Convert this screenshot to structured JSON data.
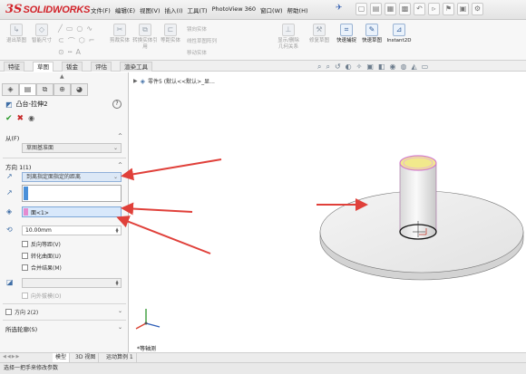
{
  "app": {
    "logo_mark": "3S",
    "logo_text": "SOLIDWORKS"
  },
  "menu": [
    "文件(F)",
    "编辑(E)",
    "视图(V)",
    "插入(I)",
    "工具(T)",
    "PhotoView 360",
    "窗口(W)",
    "帮助(H)"
  ],
  "ribbon": {
    "buttons": [
      {
        "label": "退出草图"
      },
      {
        "label": "智能尺寸"
      },
      {
        "label": "剪裁实体"
      },
      {
        "label": "转换实体引用"
      },
      {
        "label": "等距实体"
      },
      {
        "label": "显示/删除几何关系"
      },
      {
        "label": "修复草图"
      },
      {
        "label": "快速捕捉"
      },
      {
        "label": "快速草图"
      },
      {
        "label": "Instant2D"
      }
    ],
    "small_cmds": [
      "镜向实体",
      "线性草图阵列",
      "移动实体"
    ]
  },
  "cm_tabs": [
    "特征",
    "草图",
    "钣金",
    "评估",
    "渲染工具"
  ],
  "tree_flyout": "零件5 (默认<<默认>_显...",
  "property_manager": {
    "title": "凸台-拉伸2",
    "help": "?",
    "from": {
      "header": "从(F)",
      "value": "草图基准面"
    },
    "direction1": {
      "header": "方向 1(1)",
      "end_condition": "到离指定面指定的距离",
      "face_selection": "面<1>",
      "distance": "10.00mm",
      "checkboxes": [
        "反向等距(V)",
        "转化曲面(U)",
        "合并结果(M)"
      ],
      "draft_outward": "向外拔模(O)"
    },
    "direction2": {
      "header": "方向 2(2)"
    },
    "contours": {
      "header": "所选轮廓(S)"
    }
  },
  "view_label": "*等轴测",
  "bottom_tabs": [
    "模型",
    "3D 视图",
    "运动算例 1"
  ],
  "status": "选择一把手来修改参数",
  "colors": {
    "arrow": "#e0403a",
    "accent": "#4a90d9",
    "face": "#e6a8e0"
  }
}
